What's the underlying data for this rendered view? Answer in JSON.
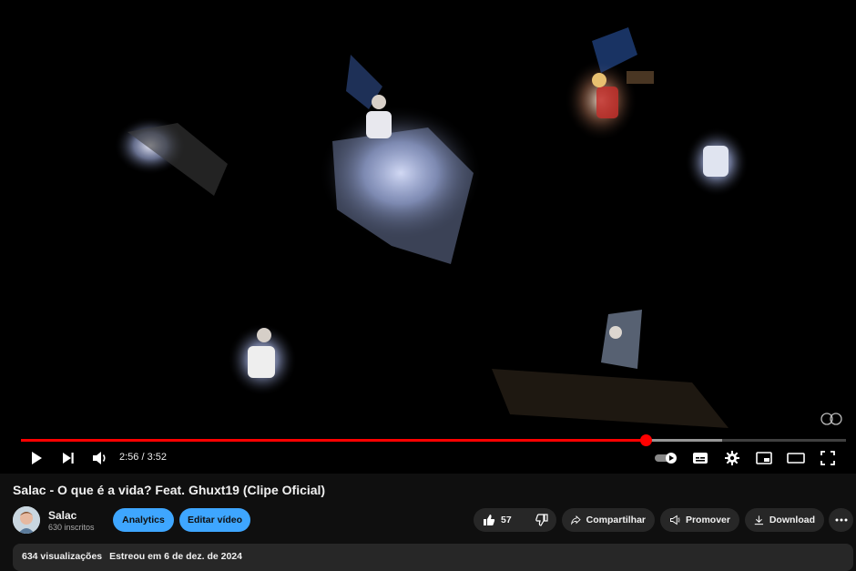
{
  "player": {
    "current_time": "2:56",
    "duration": "3:52",
    "time_separator": " / ",
    "played_fraction": 0.757,
    "buffered_fraction": 0.85,
    "accent_color": "#ff0000"
  },
  "video": {
    "title": "Salac - O que é a vida? Feat. Ghuxt19 (Clipe Oficial)"
  },
  "channel": {
    "name": "Salac",
    "subscribers": "630 inscritos"
  },
  "buttons": {
    "analytics": "Analytics",
    "edit_video": "Editar vídeo",
    "likes": "57",
    "share": "Compartilhar",
    "promote": "Promover",
    "download": "Download"
  },
  "description": {
    "views": "634 visualizações",
    "premiere": "Estreou em 6 de dez. de 2024"
  },
  "colors": {
    "background": "#0f0f0f",
    "pill_dark": "#272727",
    "pill_blue": "#3ea6ff"
  }
}
